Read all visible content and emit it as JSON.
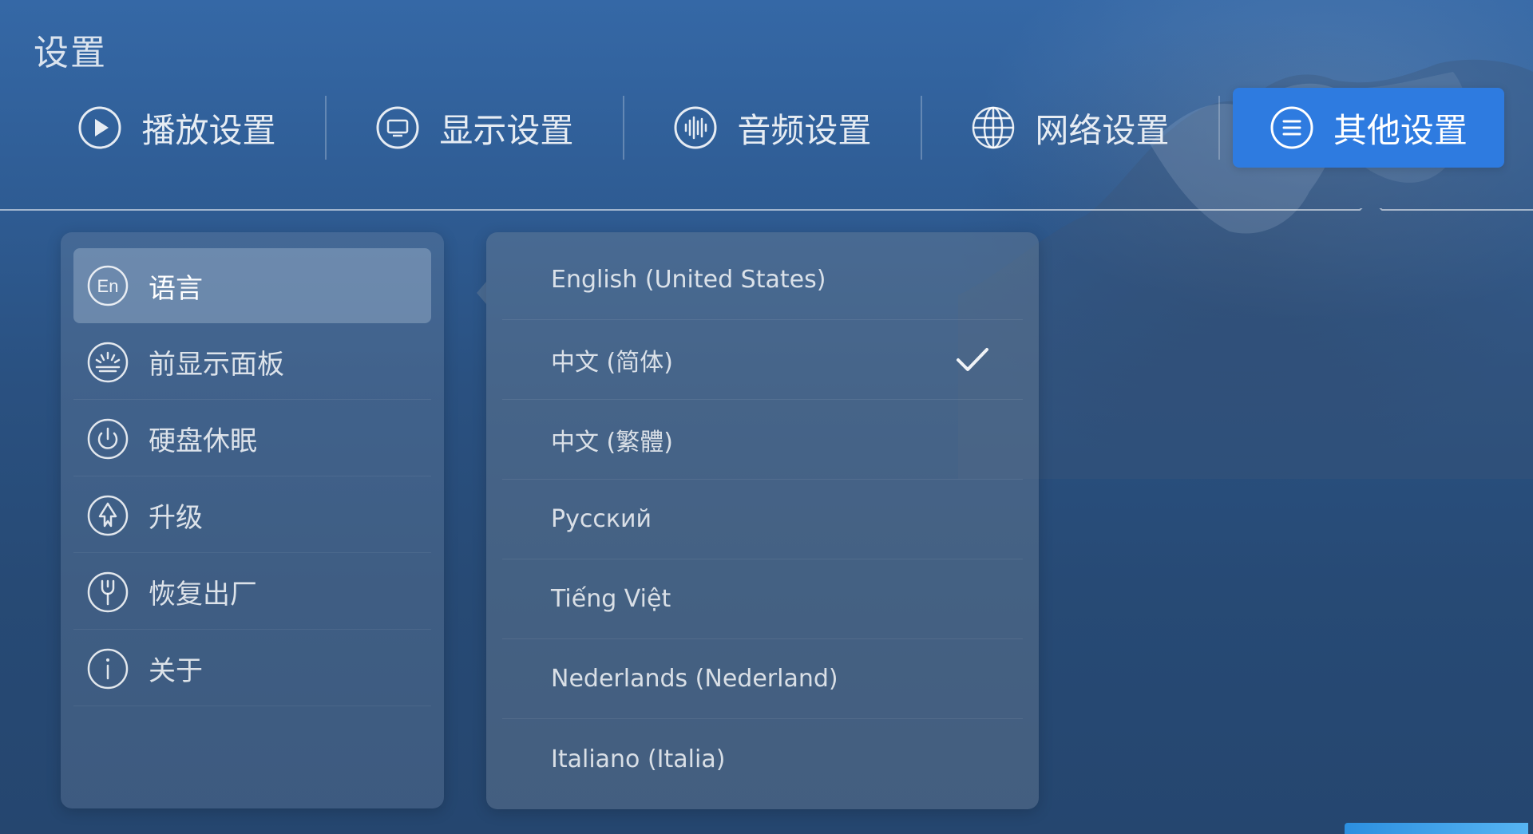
{
  "page": {
    "title": "设置"
  },
  "tabs": [
    {
      "label": "播放设置",
      "icon": "play-circle-icon",
      "active": false
    },
    {
      "label": "显示设置",
      "icon": "monitor-icon",
      "active": false
    },
    {
      "label": "音频设置",
      "icon": "audio-wave-icon",
      "active": false
    },
    {
      "label": "网络设置",
      "icon": "globe-icon",
      "active": false
    },
    {
      "label": "其他设置",
      "icon": "menu-list-icon",
      "active": true
    }
  ],
  "sidebar": {
    "items": [
      {
        "label": "语言",
        "icon": "language-en-icon",
        "icon_text": "En",
        "active": true
      },
      {
        "label": "前显示面板",
        "icon": "front-panel-icon",
        "active": false
      },
      {
        "label": "硬盘休眠",
        "icon": "power-icon",
        "active": false
      },
      {
        "label": "升级",
        "icon": "upgrade-icon",
        "active": false
      },
      {
        "label": "恢复出厂",
        "icon": "wrench-icon",
        "active": false
      },
      {
        "label": "关于",
        "icon": "info-icon",
        "active": false
      }
    ]
  },
  "language_options": {
    "items": [
      {
        "label": "English (United States)",
        "selected": false
      },
      {
        "label": "中文 (简体)",
        "selected": true
      },
      {
        "label": "中文 (繁體)",
        "selected": false
      },
      {
        "label": "Русский",
        "selected": false
      },
      {
        "label": "Tiếng Việt",
        "selected": false
      },
      {
        "label": "Nederlands (Nederland)",
        "selected": false
      },
      {
        "label": "Italiano (Italia)",
        "selected": false
      }
    ]
  },
  "colors": {
    "accent": "#2e7be0",
    "background_top": "#3568a6",
    "background_bottom": "#25466f"
  }
}
